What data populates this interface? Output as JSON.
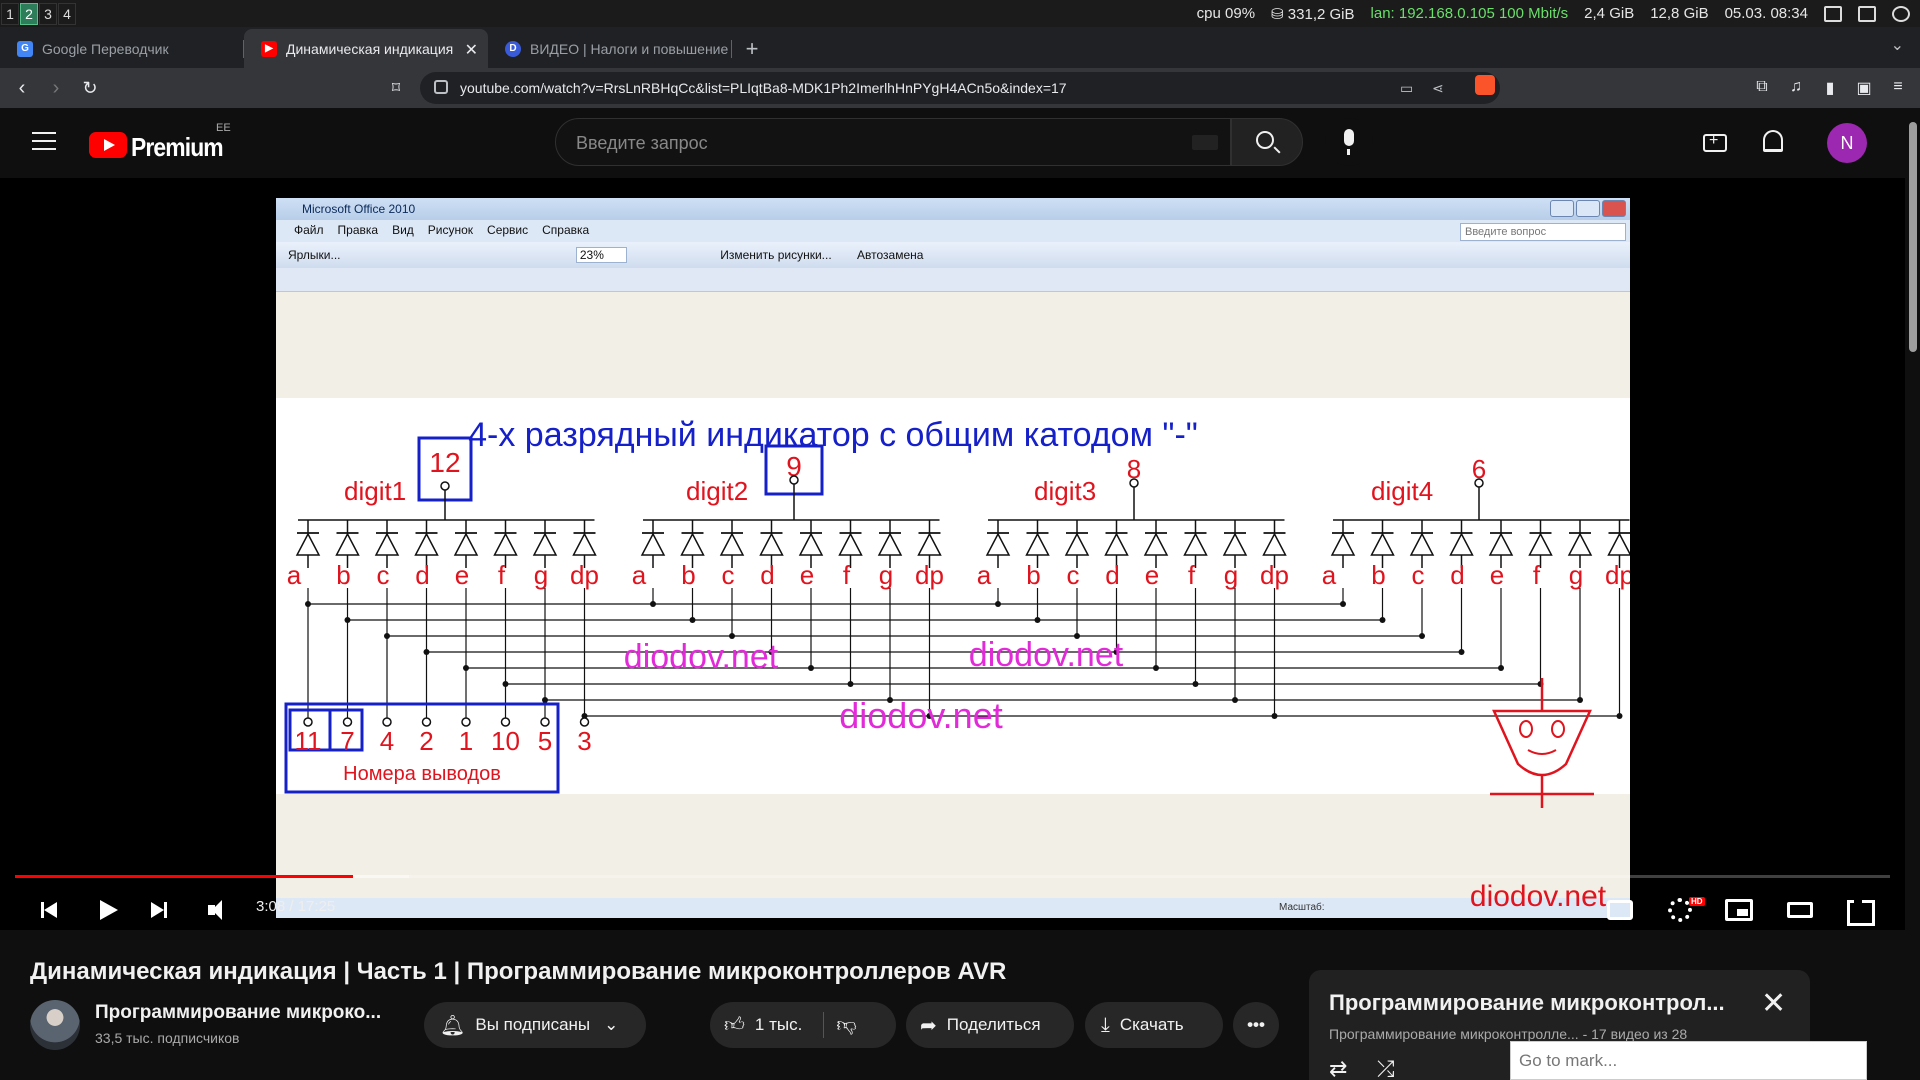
{
  "system_bar": {
    "workspaces": [
      "1",
      "2",
      "3",
      "4"
    ],
    "active_workspace": "2",
    "cpu_label": "cpu",
    "cpu_value": "09%",
    "disk": "331,2 GiB",
    "lan": "lan: 192.168.0.105 100 Mbit/s",
    "mem_used": "2,4 GiB",
    "mem_total": "12,8 GiB",
    "datetime": "05.03. 08:34"
  },
  "browser": {
    "tabs": [
      {
        "title": "Google Переводчик",
        "favicon": "google-translate-icon",
        "active": false
      },
      {
        "title": "Динамическая индикация",
        "favicon": "youtube-icon",
        "active": true
      },
      {
        "title": "ВИДЕО | Налоги и повышение",
        "favicon": "d-icon",
        "active": false
      }
    ],
    "new_tab_glyph": "+",
    "url": "youtube.com/watch?v=RrsLnRBHqCc&list=PLIqtBa8-MDK1Ph2ImerlhHnPYgH4ACn5o&index=17"
  },
  "youtube": {
    "logo_text": "Premium",
    "country_code": "EE",
    "search_placeholder": "Введите запрос",
    "avatar_letter": "N",
    "accent_color": "#ff0000"
  },
  "video_frame": {
    "window_title": "Microsoft Office 2010",
    "menu": [
      "Файл",
      "Правка",
      "Вид",
      "Рисунок",
      "Сервис",
      "Справка"
    ],
    "ask_placeholder": "Введите вопрос",
    "toolbar": {
      "shortcuts": "Ярлыки...",
      "zoom": "23%",
      "edit_pictures": "Изменить рисунки...",
      "autocorrect": "Автозамена"
    },
    "status_zoom_label": "Масштаб:",
    "diagram": {
      "heading": "4-х разрядный индикатор с общим катодом \"-\"",
      "digits": [
        {
          "label": "digit1",
          "pin": "12"
        },
        {
          "label": "digit2",
          "pin": "9"
        },
        {
          "label": "digit3",
          "pin": "8"
        },
        {
          "label": "digit4",
          "pin": "6"
        }
      ],
      "segments": [
        "a",
        "b",
        "c",
        "d",
        "e",
        "f",
        "g",
        "dp"
      ],
      "segment_pins": [
        "11",
        "7",
        "4",
        "2",
        "1",
        "10",
        "5",
        "3"
      ],
      "pins_caption": "Номера выводов",
      "watermarks": [
        "diodov.net",
        "diodov.net",
        "diodov.net",
        "diodov.net"
      ]
    }
  },
  "player": {
    "current_time": "3:08",
    "duration": "17:25",
    "time_separator": " / ",
    "played_fraction": 0.18,
    "buffered_fraction": 0.21,
    "hd_badge": "HD"
  },
  "video": {
    "title": "Динамическая индикация | Часть 1 | Программирование микроконтроллеров AVR",
    "channel_name": "Программирование микроко...",
    "subscribers": "33,5 тыс. подписчиков",
    "subscribed_label": "Вы подписаны",
    "likes": "1 тыс.",
    "share_label": "Поделиться",
    "download_label": "Скачать"
  },
  "playlist": {
    "title": "Программирование микроконтрол...",
    "channel": "Программирование микроконтролле...",
    "position": "- 17 видео из 28"
  },
  "overlay": {
    "goto_placeholder": "Go to mark..."
  }
}
